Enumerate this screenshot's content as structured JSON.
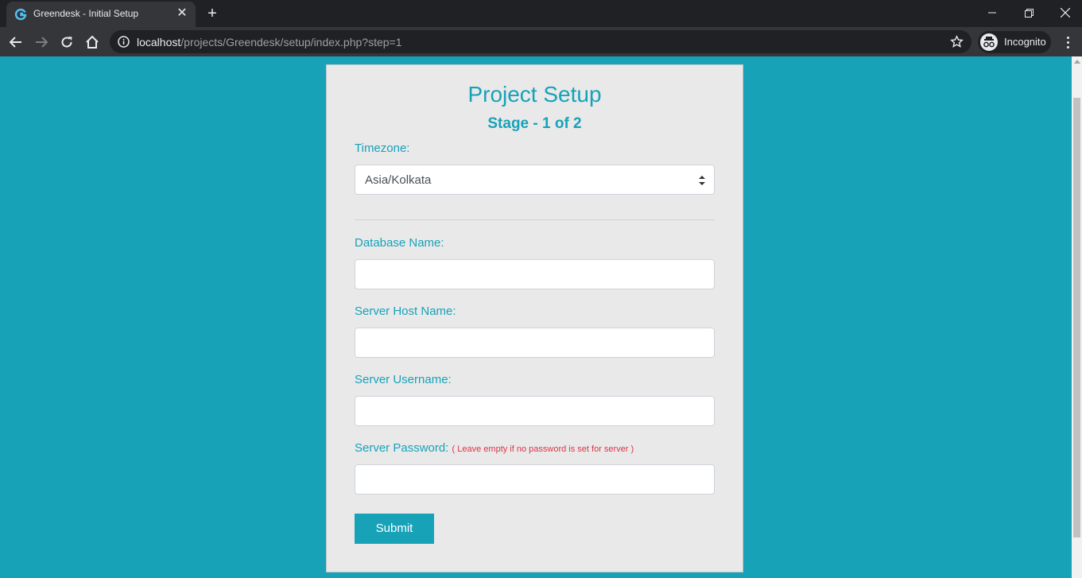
{
  "browser": {
    "tab_title": "Greendesk - Initial Setup",
    "url_host": "localhost",
    "url_path": "/projects/Greendesk/setup/index.php?step=1",
    "incognito_label": "Incognito"
  },
  "page": {
    "title": "Project Setup",
    "subtitle": "Stage - 1 of 2",
    "timezone": {
      "label": "Timezone:",
      "value": "Asia/Kolkata"
    },
    "db_name": {
      "label": "Database Name:",
      "value": ""
    },
    "server_host": {
      "label": "Server Host Name:",
      "value": ""
    },
    "server_user": {
      "label": "Server Username:",
      "value": ""
    },
    "server_password": {
      "label": "Server Password:",
      "note": "( Leave empty if no password is set for server )",
      "value": ""
    },
    "submit_label": "Submit"
  },
  "colors": {
    "accent": "#17a2b8",
    "card_bg": "#e9e9e9",
    "note": "#dc3545",
    "chrome_dark": "#202124",
    "chrome_toolbar": "#35363a"
  },
  "icons": [
    "greendesk-favicon",
    "close-icon",
    "plus-icon",
    "minimize-icon",
    "restore-icon",
    "window-close-icon",
    "back-icon",
    "forward-icon",
    "reload-icon",
    "home-icon",
    "info-icon",
    "star-icon",
    "incognito-icon",
    "more-vert-icon",
    "select-arrows-icon"
  ]
}
